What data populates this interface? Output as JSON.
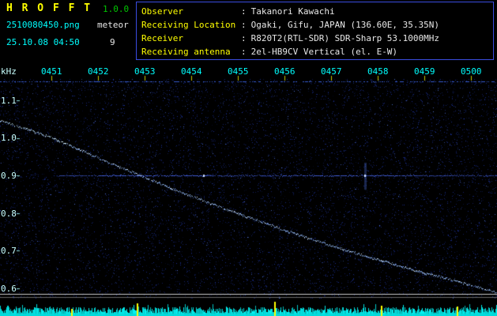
{
  "header": {
    "app_name": "H R O F F T",
    "version": "1.0.0",
    "filename": "2510080450.png",
    "mode_label": "meteor",
    "timestamp": "25.10.08 04:50",
    "event_count": "9",
    "colon": ":",
    "info_rows": [
      {
        "label": "Observer",
        "value": "Takanori Kawachi"
      },
      {
        "label": "Receiving Location",
        "value": "Ogaki, Gifu, JAPAN (136.60E, 35.35N)"
      },
      {
        "label": "Receiver",
        "value": "R820T2(RTL-SDR) SDR-Sharp 53.1000MHz"
      },
      {
        "label": "Receiving antenna",
        "value": "2el-HB9CV Vertical (el. E-W)"
      }
    ]
  },
  "chart_data": {
    "type": "heatmap",
    "title": "",
    "ylabel": "kHz",
    "x_tick_labels": [
      "0451",
      "0452",
      "0453",
      "0454",
      "0455",
      "0456",
      "0457",
      "0458",
      "0459",
      "0500"
    ],
    "y_tick_labels": [
      "1.1",
      "1.0",
      "0.9",
      "0.8",
      "0.7",
      "0.6"
    ],
    "y_tick_khz": [
      1.1,
      1.0,
      0.9,
      0.8,
      0.7,
      0.6
    ],
    "ylim_khz": [
      0.56,
      1.16
    ],
    "x_range_min": [
      -0.11,
      10.6
    ],
    "carrier_trace": {
      "color": "#9cc4ff",
      "points_min_khz": [
        [
          -0.11,
          1.048
        ],
        [
          1,
          1.002
        ],
        [
          2,
          0.948
        ],
        [
          3,
          0.896
        ],
        [
          4,
          0.846
        ],
        [
          5,
          0.8
        ],
        [
          6,
          0.756
        ],
        [
          7,
          0.715
        ],
        [
          8,
          0.677
        ],
        [
          9,
          0.642
        ],
        [
          10,
          0.61
        ],
        [
          10.6,
          0.588
        ]
      ]
    },
    "reference_line": {
      "khz": 0.9,
      "start_min": 1.15,
      "color": "#3c5ae6"
    },
    "echoes": [
      {
        "min": 4.27,
        "khz": 0.9,
        "smear": false
      },
      {
        "min": 7.73,
        "khz": 0.9,
        "smear": true
      }
    ],
    "marker_lines": [
      {
        "khz": 0.585,
        "color": "#c8c8c8"
      },
      {
        "khz": 0.577,
        "color": "#6a6a6a"
      }
    ],
    "level_strip": {
      "bar_color": "#00d8d8",
      "spike_color": "#ffff00",
      "spikes": [
        {
          "min": 1.42,
          "height": 9
        },
        {
          "min": 2.83,
          "height": 16
        },
        {
          "min": 5.78,
          "height": 18
        },
        {
          "min": 8.07,
          "height": 13
        },
        {
          "min": 9.69,
          "height": 12
        }
      ]
    },
    "noise_color": "#2846dc",
    "tick_color": "#c8c800"
  },
  "colors": {
    "background": "#000000",
    "title_yellow": "#ffff00",
    "version_green": "#00c800",
    "cyan_text": "#00ffff",
    "white_text": "#e8e8e8",
    "info_border": "#3a4ce0",
    "axis_label": "#c8ffff"
  }
}
